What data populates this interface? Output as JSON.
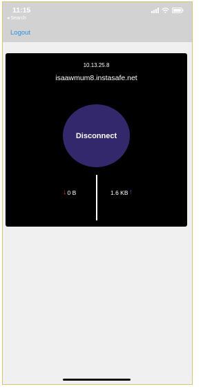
{
  "status_bar": {
    "time": "11:15",
    "back_label": "◂ Search",
    "icons": [
      "signal-icon",
      "wifi-icon",
      "battery-icon"
    ]
  },
  "nav": {
    "logout_label": "Logout"
  },
  "connection": {
    "ip": "10.13.25.8",
    "host": "isaawmum8.instasafe.net",
    "disconnect_label": "Disconnect",
    "download_value": "0 B",
    "upload_value": "1.6 KB",
    "download_arrow": "↓",
    "upload_arrow": "↑"
  },
  "colors": {
    "accent_link": "#2f8fe8",
    "disconnect_button": "#34286c",
    "card_background": "#000000",
    "download_arrow": "#e8302a",
    "upload_arrow": "#3b3fae"
  }
}
